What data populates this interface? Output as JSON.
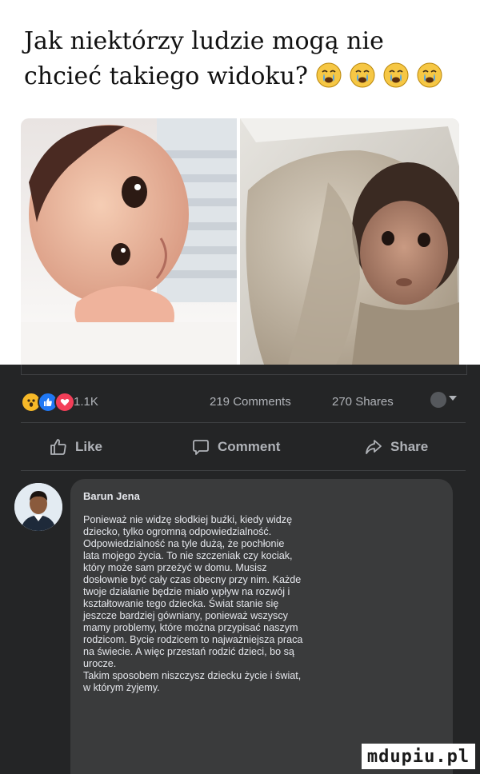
{
  "meme": {
    "title_line1": "Jak niektórzy ludzie mogą nie",
    "title_line2": "chcieć takiego widoku?",
    "emoji": [
      "crying-face-icon",
      "crying-face-icon",
      "crying-face-icon",
      "crying-face-icon"
    ]
  },
  "post": {
    "reaction_icons": [
      "wow-reaction-icon",
      "like-reaction-icon",
      "love-reaction-icon"
    ],
    "reaction_count": "1.1K",
    "comments_count": "219 Comments",
    "shares_count": "270 Shares",
    "actions": {
      "like": "Like",
      "comment": "Comment",
      "share": "Share"
    }
  },
  "comment": {
    "author": "Barun Jena",
    "lines": [
      "Ponieważ nie widzę słodkiej buźki, kiedy widzę",
      "dziecko, tylko ogromną odpowiedzialność.",
      "Odpowiedzialność na tyle dużą, że pochłonie",
      "lata mojego życia. To nie szczeniak czy kociak,",
      "który może sam przeżyć w domu. Musisz",
      "dosłownie być cały czas obecny przy nim. Każde",
      "twoje działanie będzie miało wpływ na rozwój i",
      "kształtowanie tego dziecka. Świat stanie się",
      "jeszcze bardziej gówniany, ponieważ wszyscy",
      "mamy problemy, które można przypisać naszym",
      "rodzicom. Bycie rodzicem to najważniejsza praca",
      "na świecie. A więc przestań rodzić dzieci, bo są",
      "urocze.",
      "Takim sposobem niszczysz dziecku życie i świat,",
      "w którym żyjemy."
    ]
  },
  "watermark": "mdupiu.pl",
  "colors": {
    "post_background": "#242526",
    "bubble_background": "#3a3b3c",
    "text_primary": "#e4e6eb",
    "text_secondary": "#b0b3b8"
  }
}
